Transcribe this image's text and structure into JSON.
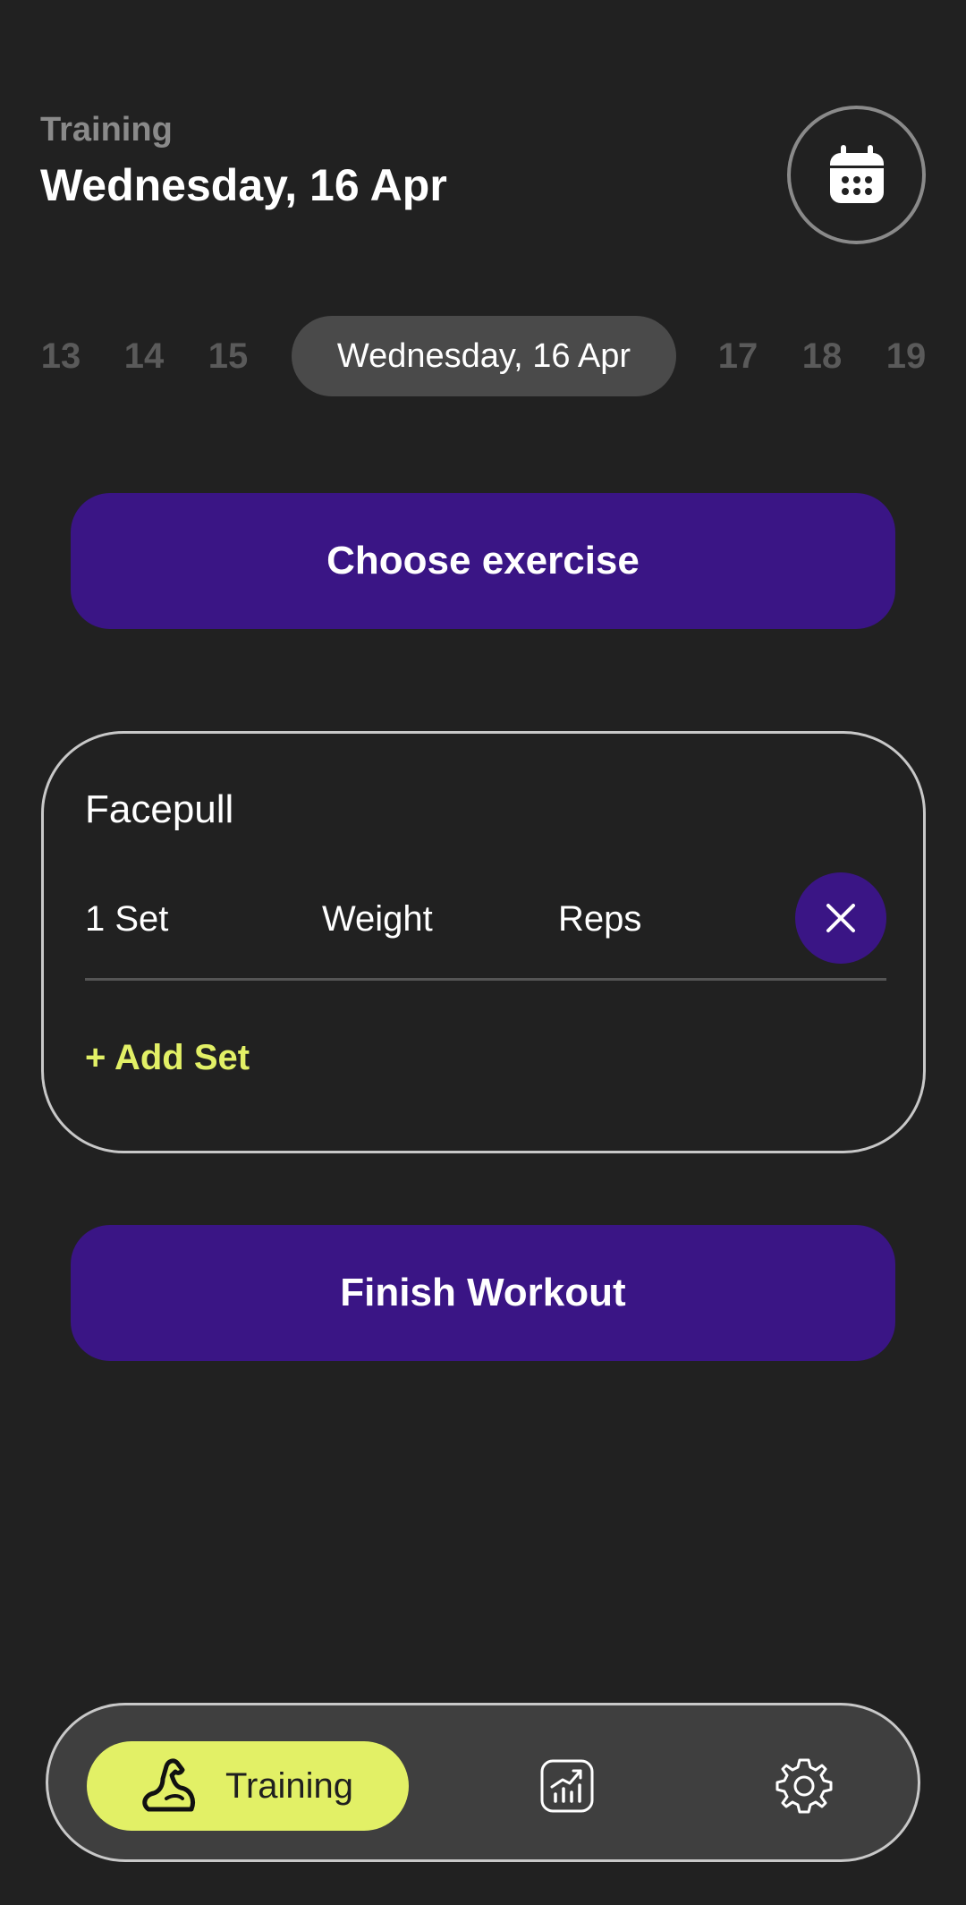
{
  "header": {
    "subtitle": "Training",
    "title": "Wednesday, 16 Apr",
    "calendar_icon": "calendar-icon"
  },
  "date_strip": {
    "before": [
      "13",
      "14",
      "15"
    ],
    "selected": "Wednesday, 16 Apr",
    "after": [
      "17",
      "18",
      "19"
    ]
  },
  "actions": {
    "choose_exercise": "Choose exercise",
    "finish_workout": "Finish Workout"
  },
  "exercise": {
    "name": "Facepull",
    "columns": {
      "set": "1 Set",
      "weight": "Weight",
      "reps": "Reps"
    },
    "remove_icon": "close-icon",
    "add_set": "+ Add Set"
  },
  "bottom_nav": {
    "active": {
      "label": "Training",
      "icon": "flexed-bicep-icon"
    },
    "items": [
      {
        "icon": "stats-chart-icon"
      },
      {
        "icon": "gear-icon"
      }
    ]
  },
  "colors": {
    "background": "#212121",
    "primary": "#3a1585",
    "accent": "#e2f066",
    "pill": "#4a4a4a",
    "nav_bg": "#3f3f3f"
  }
}
